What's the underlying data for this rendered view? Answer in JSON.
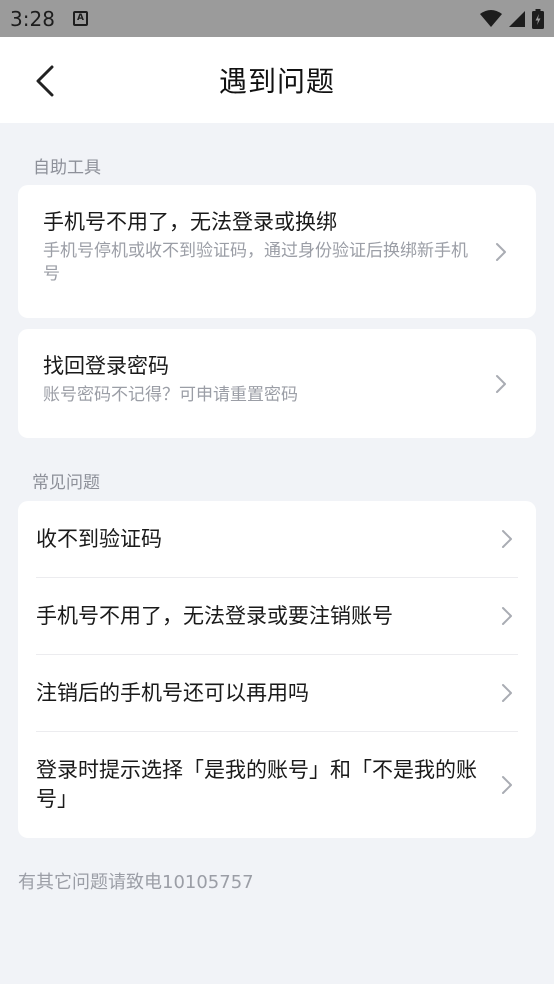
{
  "status_bar": {
    "time": "3:28",
    "notification_icon": "A"
  },
  "nav": {
    "title": "遇到问题"
  },
  "self_help": {
    "section_label": "自助工具",
    "items": [
      {
        "title": "手机号不用了，无法登录或换绑",
        "description": "手机号停机或收不到验证码，通过身份验证后换绑新手机号"
      },
      {
        "title": "找回登录密码",
        "description": "账号密码不记得？可申请重置密码"
      }
    ]
  },
  "faq": {
    "section_label": "常见问题",
    "items": [
      {
        "label": "收不到验证码"
      },
      {
        "label": "手机号不用了，无法登录或要注销账号"
      },
      {
        "label": "注销后的手机号还可以再用吗"
      },
      {
        "label": "登录时提示选择「是我的账号」和「不是我的账号」"
      }
    ]
  },
  "footer": {
    "note": "有其它问题请致电10105757"
  }
}
